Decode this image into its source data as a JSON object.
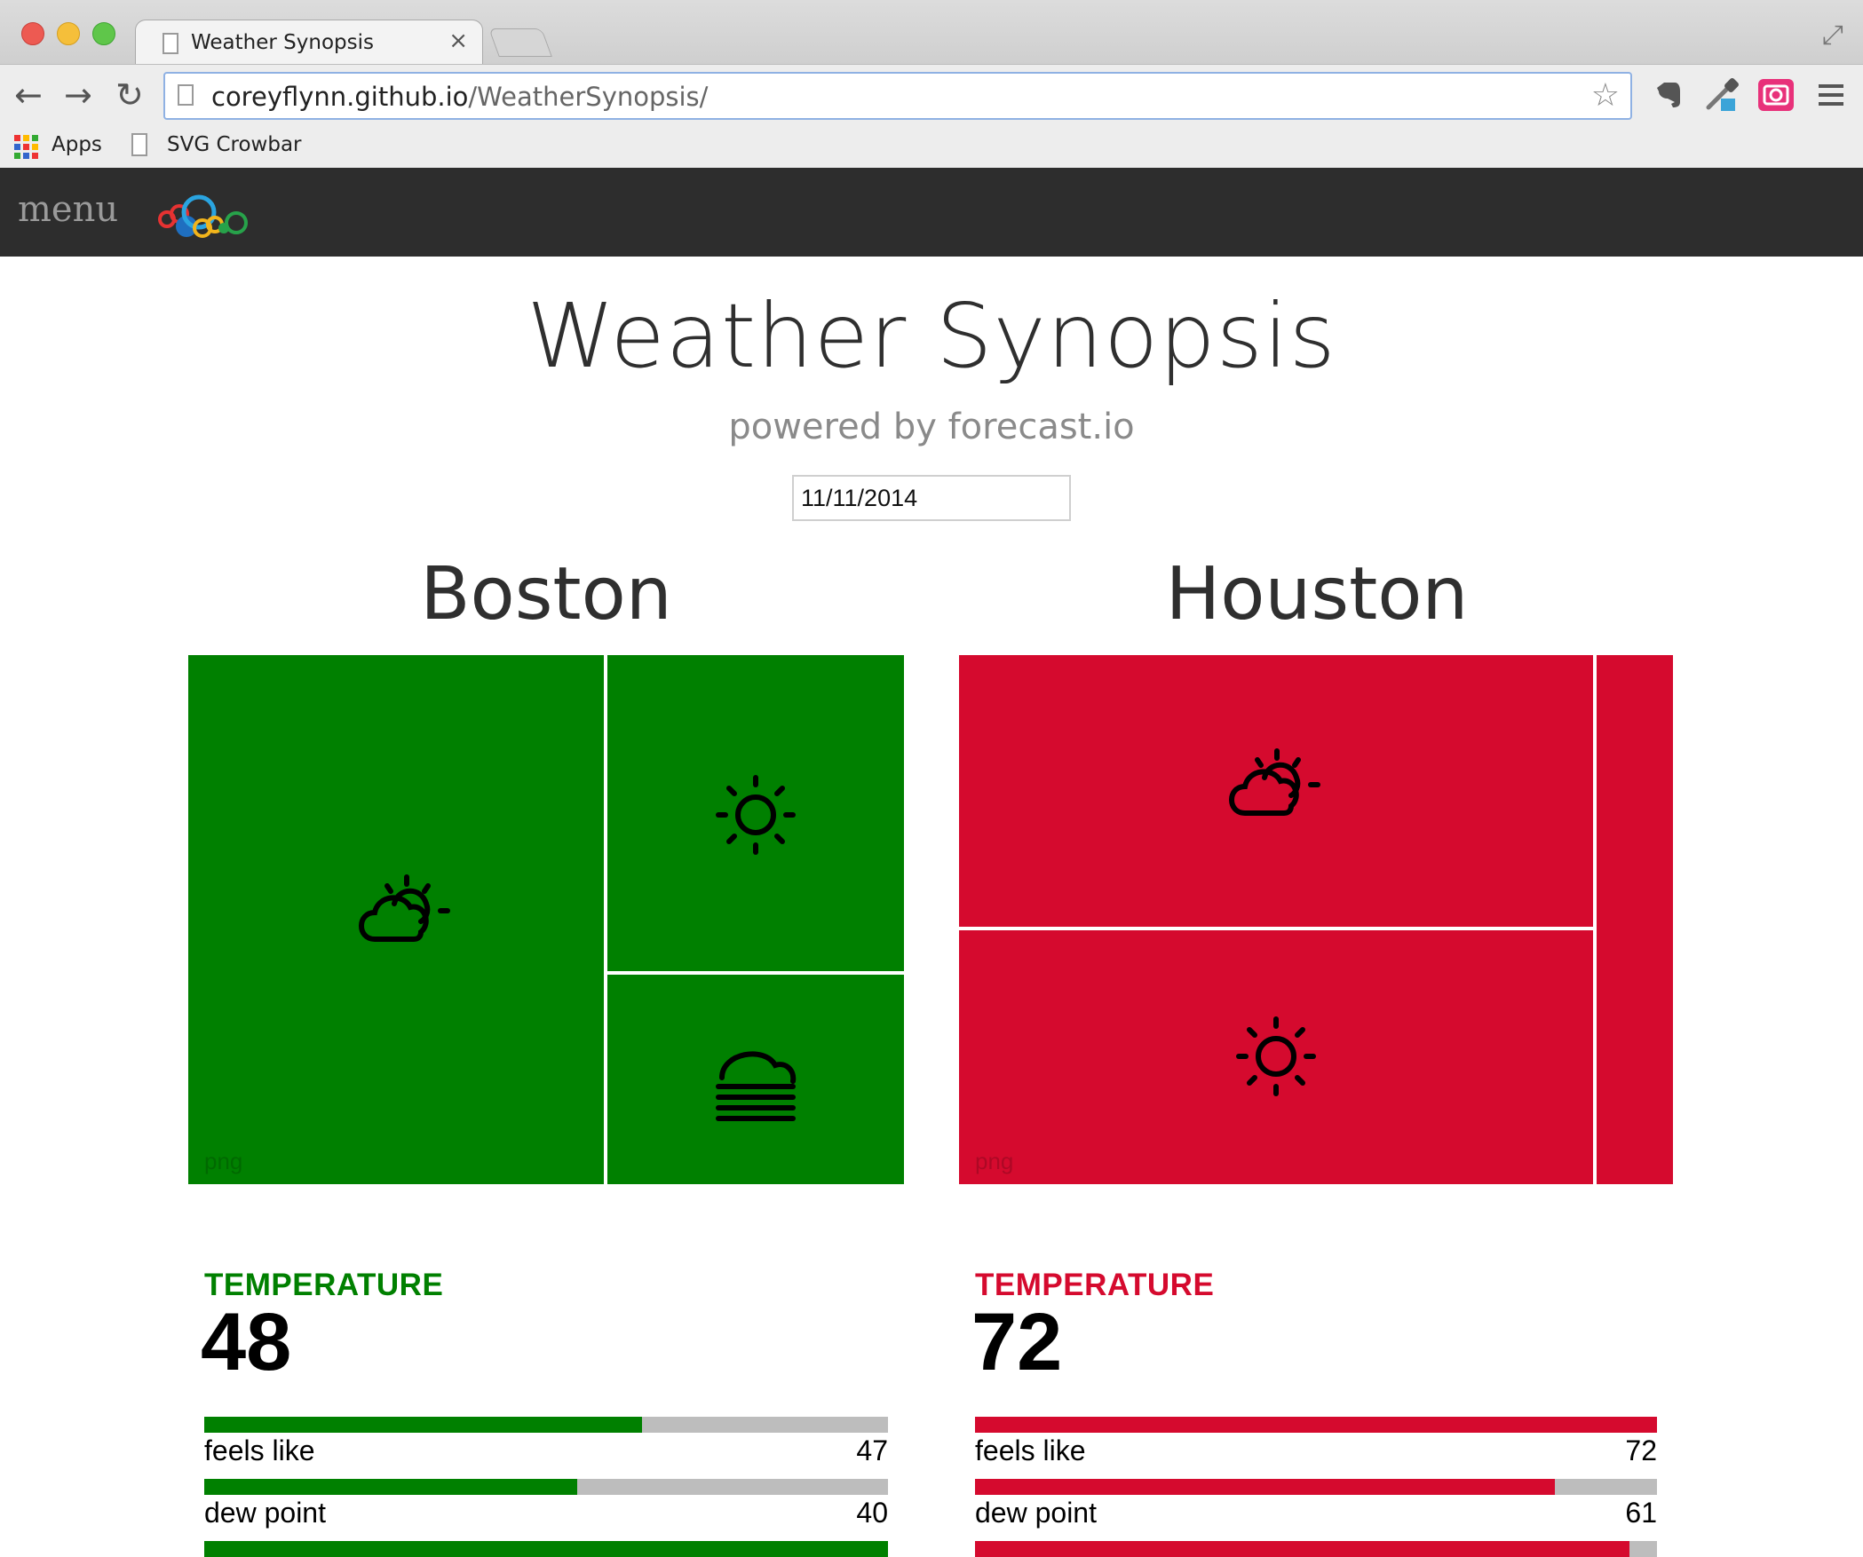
{
  "browser": {
    "tab_title": "Weather Synopsis",
    "tab_close": "×",
    "url_host": "coreyflynn.github.io",
    "url_path": "/WeatherSynopsis/",
    "bookmarks": [
      {
        "label": "Apps",
        "icon": "apps-grid-icon"
      },
      {
        "label": "SVG Crowbar",
        "icon": "page-icon"
      }
    ]
  },
  "sitenav": {
    "menu_label": "menu",
    "logo": "bubbles-logo"
  },
  "page": {
    "title": "Weather Synopsis",
    "subtitle": "powered by forecast.io",
    "date_value": "11/11/2014"
  },
  "colors": {
    "boston": "#008000",
    "houston": "#d50a2e",
    "bar_bg": "#bdbdbd"
  },
  "cities": [
    {
      "name": "Boston",
      "tiles": [
        {
          "icon": "partly-cloudy-day-icon"
        },
        {
          "icon": "clear-day-icon"
        },
        {
          "icon": "fog-icon"
        }
      ],
      "png_label": "png",
      "metric_label": "TEMPERATURE",
      "metric_value": "48",
      "stats": [
        {
          "label": "feels like",
          "value": "47",
          "fill_fraction": 0.64
        },
        {
          "label": "dew point",
          "value": "40",
          "fill_fraction": 0.545
        },
        {
          "label": "",
          "value": "",
          "fill_fraction": 1.0
        }
      ]
    },
    {
      "name": "Houston",
      "tiles": [
        {
          "icon": "partly-cloudy-day-icon"
        },
        {
          "icon": "clear-day-icon"
        },
        {
          "icon": ""
        }
      ],
      "png_label": "png",
      "metric_label": "TEMPERATURE",
      "metric_value": "72",
      "stats": [
        {
          "label": "feels like",
          "value": "72",
          "fill_fraction": 1.0
        },
        {
          "label": "dew point",
          "value": "61",
          "fill_fraction": 0.85
        },
        {
          "label": "",
          "value": "",
          "fill_fraction": 0.96
        }
      ]
    }
  ]
}
